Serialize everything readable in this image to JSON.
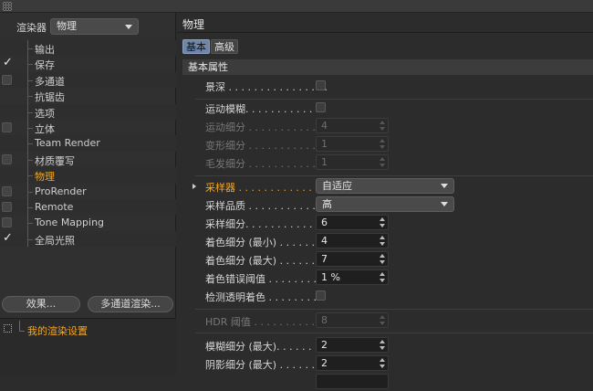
{
  "left": {
    "renderer_label": "渲染器",
    "renderer_value": "物理",
    "items": [
      {
        "label": "输出",
        "checkbox": false,
        "checked": false,
        "active": false
      },
      {
        "label": "保存",
        "checkbox": false,
        "checked": true,
        "active": false
      },
      {
        "label": "多通道",
        "checkbox": true,
        "checked": false,
        "active": false
      },
      {
        "label": "抗锯齿",
        "checkbox": false,
        "checked": false,
        "active": false
      },
      {
        "label": "选项",
        "checkbox": false,
        "checked": false,
        "active": false
      },
      {
        "label": "立体",
        "checkbox": true,
        "checked": false,
        "active": false
      },
      {
        "label": "Team Render",
        "checkbox": false,
        "checked": false,
        "active": false
      },
      {
        "label": "材质覆写",
        "checkbox": true,
        "checked": false,
        "active": false
      },
      {
        "label": "物理",
        "checkbox": false,
        "checked": false,
        "active": true
      },
      {
        "label": "ProRender",
        "checkbox": true,
        "checked": false,
        "active": false
      },
      {
        "label": "Remote",
        "checkbox": true,
        "checked": false,
        "active": false
      },
      {
        "label": "Tone Mapping",
        "checkbox": true,
        "checked": false,
        "active": false
      },
      {
        "label": "全局光照",
        "checkbox": false,
        "checked": true,
        "active": false
      }
    ],
    "effects_button": "效果...",
    "multipass_button": "多通道渲染...",
    "preset_label": "我的渲染设置"
  },
  "right": {
    "title": "物理",
    "tabs": {
      "basic": "基本",
      "advanced": "高级"
    },
    "section": "基本属性",
    "rows": {
      "dof": {
        "label": "景深 . . . . . . . . . . . . . . . ."
      },
      "motion_blur": {
        "label": "运动模糊. . . . . . . . . . . ."
      },
      "motion_sub": {
        "label": "运动细分 . . . . . . . . . . . .",
        "value": "4"
      },
      "deform_sub": {
        "label": "变形细分 . . . . . . . . . . . .",
        "value": "1"
      },
      "hair_sub": {
        "label": "毛发细分 . . . . . . . . . . . .",
        "value": "1"
      },
      "sampler": {
        "label": "采样器 . . . . . . . . . . . . . .",
        "value": "自适应"
      },
      "sample_quality": {
        "label": "采样品质 . . . . . . . . . . . .",
        "value": "高"
      },
      "sample_sub": {
        "label": "采样细分. . . . . . . . . . . .",
        "value": "6"
      },
      "shading_min": {
        "label": "着色细分 (最小) . . . . . . .",
        "value": "4"
      },
      "shading_max": {
        "label": "着色细分 (最大) . . . . . . .",
        "value": "7"
      },
      "shading_err": {
        "label": "着色错误阈值 . . . . . . . . .",
        "value": "1 %"
      },
      "detect_transp": {
        "label": "检测透明着色 . . . . . . . . ."
      },
      "hdr": {
        "label": "HDR 阈值 . . . . . . . . . . .",
        "value": "8"
      },
      "blur_max": {
        "label": "模糊细分 (最大). . . . . . .",
        "value": "2"
      },
      "shadow_max": {
        "label": "阴影细分 (最大) . . . . . . .",
        "value": "2"
      }
    }
  }
}
